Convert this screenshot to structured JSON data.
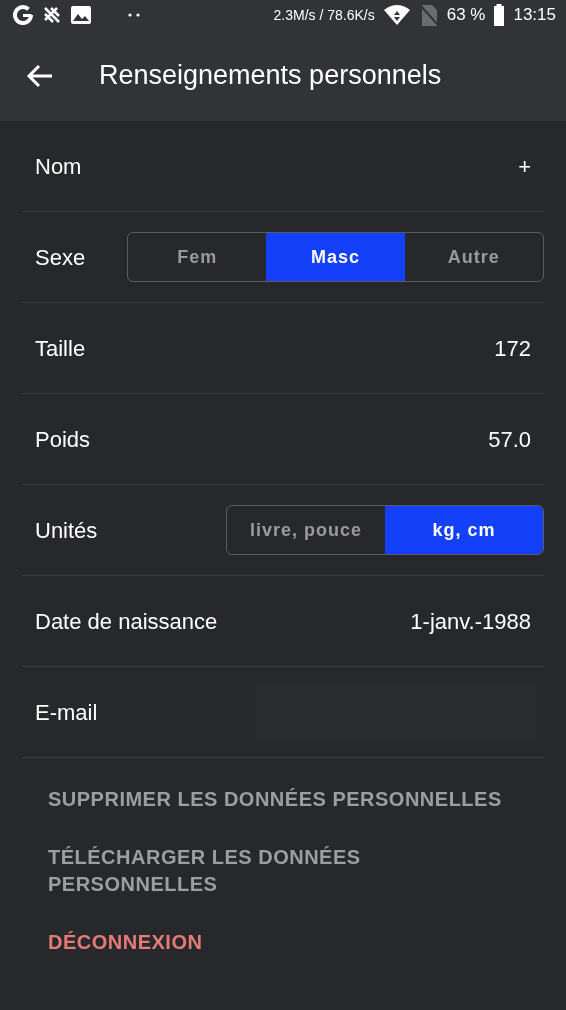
{
  "status_bar": {
    "network_speed": "2.3M/s / 78.6K/s",
    "battery": "63 %",
    "time": "13:15"
  },
  "app_bar": {
    "title": "Renseignements personnels"
  },
  "rows": [
    {
      "kind": "value",
      "label": "Nom",
      "value": "+"
    },
    {
      "kind": "segmented",
      "label": "Sexe",
      "options": [
        {
          "label": "Fem",
          "selected": false
        },
        {
          "label": "Masc",
          "selected": true
        },
        {
          "label": "Autre",
          "selected": false
        }
      ]
    },
    {
      "kind": "value",
      "label": "Taille",
      "value": "172"
    },
    {
      "kind": "value",
      "label": "Poids",
      "value": "57.0"
    },
    {
      "kind": "segmented",
      "label": "Unités",
      "options": [
        {
          "label": "livre, pouce",
          "selected": false
        },
        {
          "label": "kg, cm",
          "selected": true
        }
      ]
    },
    {
      "kind": "value",
      "label": "Date de naissance",
      "value": "1-janv.-1988"
    },
    {
      "kind": "field",
      "label": "E-mail"
    }
  ],
  "actions": [
    {
      "kind": "normal",
      "label": "SUPPRIMER LES DONNÉES PERSONNELLES"
    },
    {
      "kind": "normal",
      "label": "TÉLÉCHARGER LES DONNÉES PERSONNELLES"
    },
    {
      "kind": "danger",
      "label": "DÉCONNEXION"
    }
  ]
}
